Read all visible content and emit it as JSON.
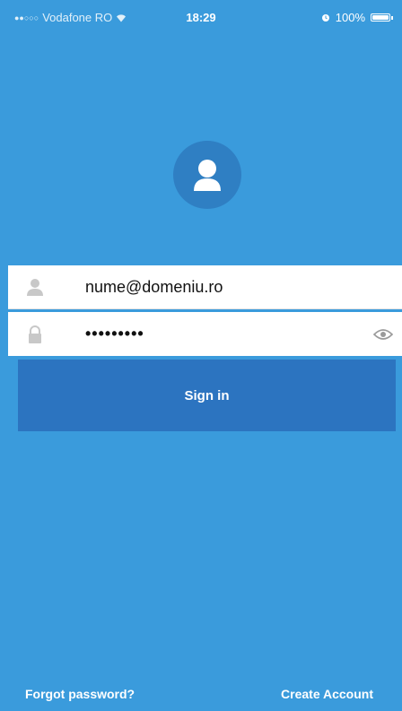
{
  "status_bar": {
    "signal": "●●○○○",
    "carrier": "Vodafone RO",
    "wifi_icon": "wifi-icon",
    "time": "18:29",
    "alarm_icon": "alarm-icon",
    "battery_text": "100%",
    "battery_level": 1.0
  },
  "avatar": {
    "icon": "user-silhouette-icon"
  },
  "form": {
    "email": {
      "icon": "user-icon",
      "value": "nume@domeniu.ro"
    },
    "password": {
      "icon": "lock-icon",
      "value": "•••••••••",
      "toggle_icon": "eye-icon"
    }
  },
  "actions": {
    "sign_in": "Sign in",
    "forgot_password": "Forgot password?",
    "create_account": "Create Account"
  },
  "colors": {
    "background": "#3a9bdc",
    "button": "#2c74c0",
    "avatar_bg": "#2f7fc3"
  }
}
